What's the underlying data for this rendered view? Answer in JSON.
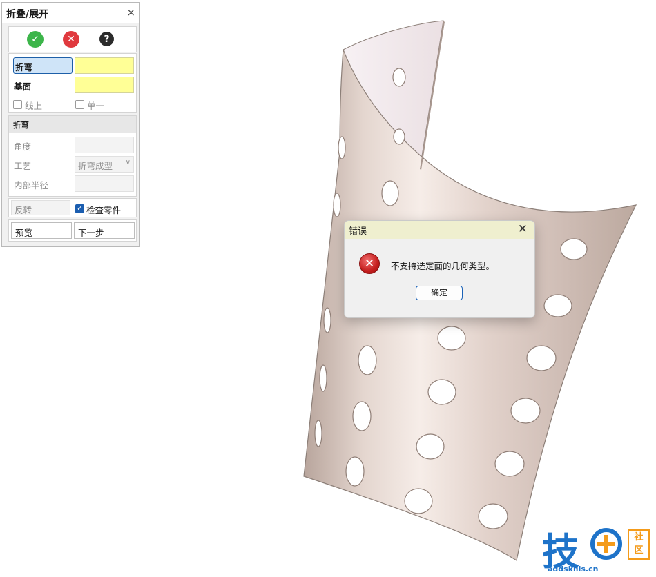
{
  "panel": {
    "title": "折叠/展开",
    "close_glyph": "×",
    "toolbar": {
      "ok_icon": "check-circle-icon",
      "cancel_icon": "x-circle-icon",
      "help_icon": "question-circle-icon",
      "ok_glyph": "✓",
      "cancel_glyph": "✕",
      "help_glyph": "?"
    },
    "selection": {
      "bend_label": "折弯",
      "base_label": "基面",
      "on_line_label": "线上",
      "single_label": "单一"
    },
    "bend_section": {
      "header": "折弯",
      "angle_label": "角度",
      "process_label": "工艺",
      "process_value": "折弯成型",
      "inner_radius_label": "内部半径"
    },
    "reverse_label": "反转",
    "check_part_label": "检查零件",
    "check_part_checked": true,
    "preview_label": "预览",
    "next_label": "下一步"
  },
  "dialog": {
    "title": "错误",
    "close_glyph": "✕",
    "message": "不支持选定面的几何类型。",
    "ok_label": "确定",
    "icon": "error-icon"
  },
  "watermark": {
    "char": "技",
    "box_text_top": "社",
    "box_text_bottom": "区",
    "url": "addskills.cn"
  },
  "colors": {
    "highlight_field": "#ffff96",
    "selected_button": "#cfe4f8",
    "dialog_title": "#efefcf",
    "ok_green": "#3cb54a",
    "cancel_red": "#e0393e",
    "help_dark": "#2b2b2b",
    "part_surface": "#dcc9c1"
  }
}
